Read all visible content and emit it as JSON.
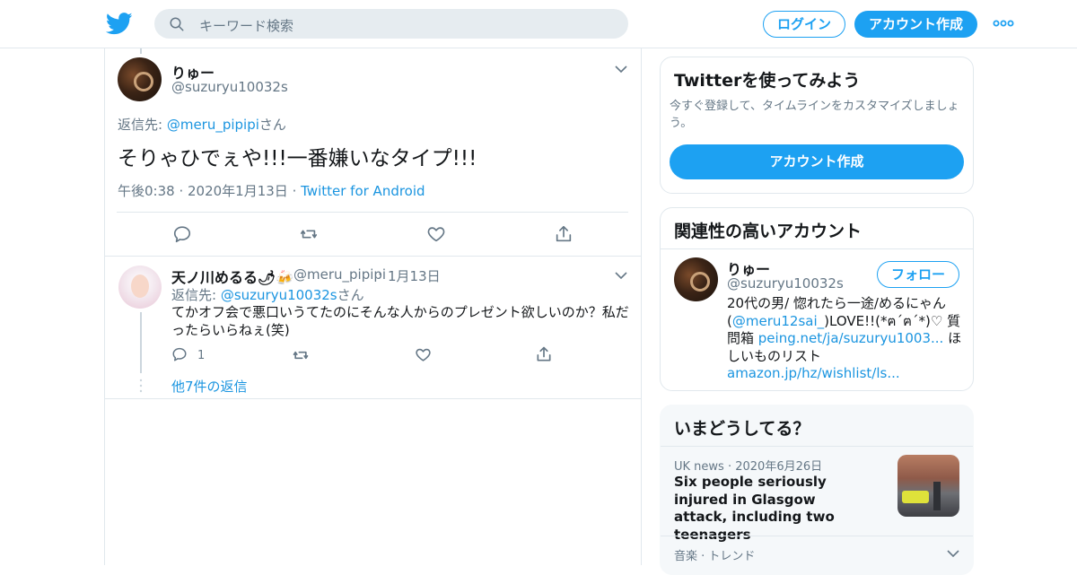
{
  "topbar": {
    "search_placeholder": "キーワード検索",
    "login_label": "ログイン",
    "signup_label": "アカウント作成"
  },
  "main_tweet": {
    "name": "りゅー",
    "handle": "@suzuryu10032s",
    "reply_prefix": "返信先: ",
    "reply_handle": "@meru_pipipi",
    "reply_suffix": "さん",
    "text": "そりゃひでぇや!!!一番嫌いなタイプ!!!",
    "time": "午後0:38",
    "date": "2020年1月13日",
    "source": "Twitter for Android"
  },
  "reply": {
    "name": "天ノ川めるる🌶🍻",
    "handle": "@meru_pipipi",
    "date": "1月13日",
    "reply_prefix": "返信先: ",
    "reply_handle": "@suzuryu10032s",
    "reply_suffix": "さん",
    "text": "てかオフ会で悪口いうてたのにそんな人からのプレゼント欲しいのか？私だったらいらねぇ(笑)",
    "reply_count": "1",
    "more_replies": "他7件の返信"
  },
  "card_try": {
    "title": "Twitterを使ってみよう",
    "subtitle": "今すぐ登録して、タイムラインをカスタマイズしましょう。",
    "button": "アカウント作成"
  },
  "card_related": {
    "title": "関連性の高いアカウント",
    "name": "りゅー",
    "handle": "@suzuryu10032s",
    "follow": "フォロー",
    "bio_1": "20代の男/ 惚れたら一途/めるにゃん(",
    "bio_link1": "@meru12sai_",
    "bio_2": ")LOVE!!(*ฅ´ฅ´*)♡ 質問箱 ",
    "bio_link2": "peing.net/ja/suzuryu1003...",
    "bio_3": " ほしいものリスト ",
    "bio_link3": "amazon.jp/hz/wishlist/ls..."
  },
  "card_trends": {
    "title": "いまどうしてる？",
    "news_category": "UK news",
    "news_date": "2020年6月26日",
    "news_title": "Six people seriously injured in Glasgow attack, including two teenagers",
    "next_category": "音楽 · トレンド"
  },
  "colors": {
    "brand": "#1da1f2",
    "link": "#1b95e0",
    "secondary_text": "#657786",
    "border": "#e1e8ed"
  },
  "icons": [
    "twitter-bird-icon",
    "search-icon",
    "more-dots-icon",
    "chevron-down-icon",
    "reply-icon",
    "retweet-icon",
    "like-icon",
    "share-icon"
  ]
}
